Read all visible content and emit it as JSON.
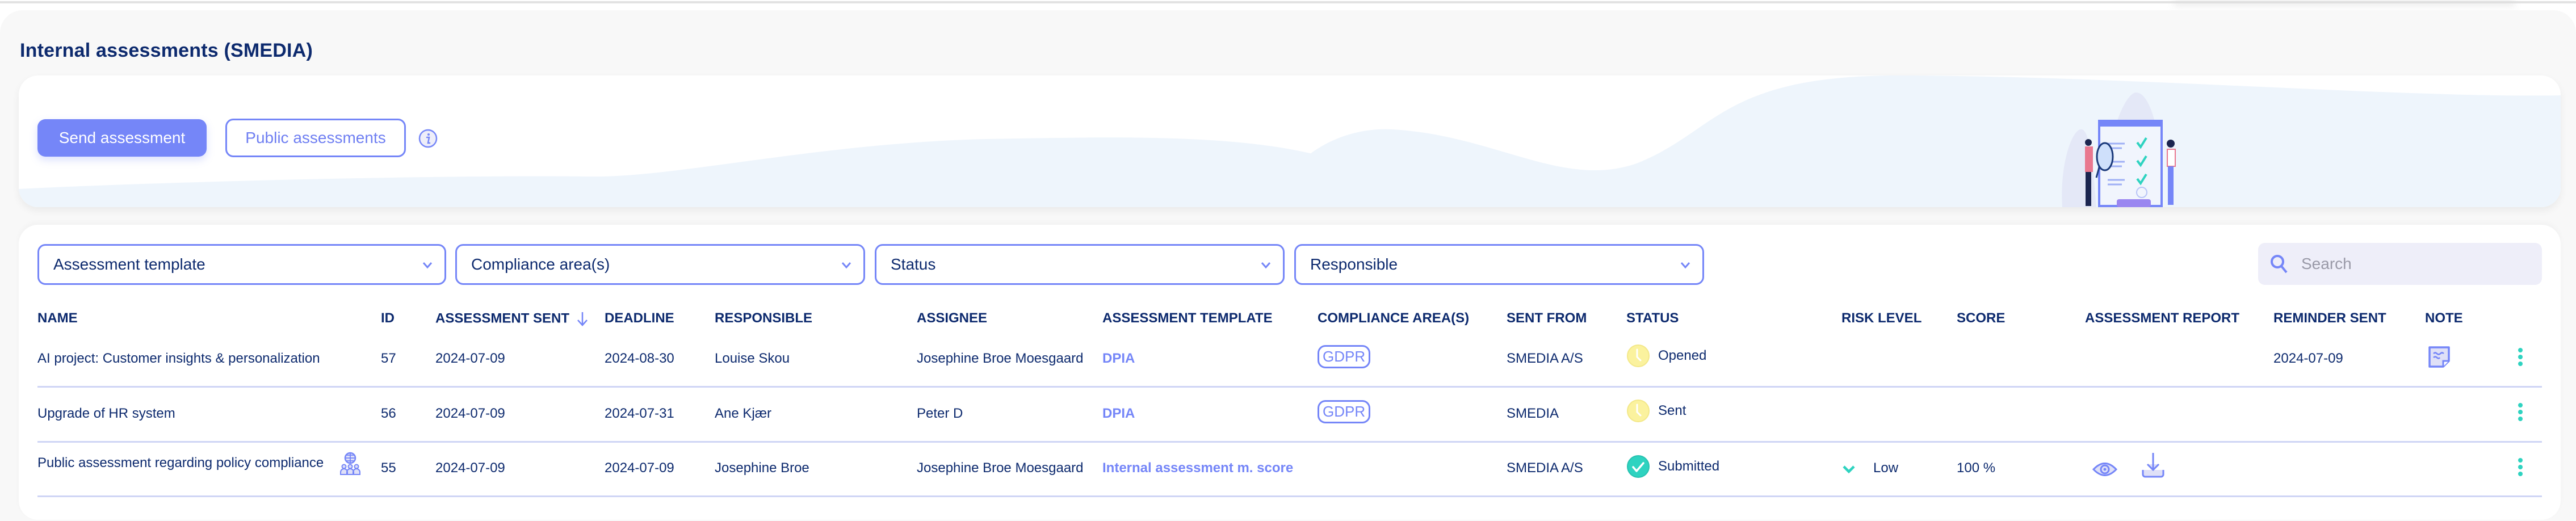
{
  "page": {
    "title": "Internal assessments (SMEDIA)"
  },
  "banner": {
    "send_label": "Send assessment",
    "public_label": "Public assessments",
    "info_icon": "info-icon"
  },
  "filters": [
    {
      "label": "Assessment template"
    },
    {
      "label": "Compliance area(s)"
    },
    {
      "label": "Status"
    },
    {
      "label": "Responsible"
    }
  ],
  "search": {
    "placeholder": "Search",
    "value": ""
  },
  "table": {
    "columns": [
      "NAME",
      "ID",
      "ASSESSMENT SENT",
      "DEADLINE",
      "RESPONSIBLE",
      "ASSIGNEE",
      "ASSESSMENT TEMPLATE",
      "COMPLIANCE AREA(S)",
      "SENT FROM",
      "STATUS",
      "RISK LEVEL",
      "SCORE",
      "ASSESSMENT REPORT",
      "REMINDER SENT",
      "NOTE"
    ],
    "sorted_column": "ASSESSMENT SENT",
    "sort_direction": "descending",
    "rows": [
      {
        "name": "AI project: Customer insights & personalization",
        "public": false,
        "id": "57",
        "sent": "2024-07-09",
        "deadline": "2024-08-30",
        "responsible": "Louise Skou",
        "assignee": "Josephine Broe Moesgaard",
        "template": "DPIA",
        "compliance": "GDPR",
        "sent_from": "SMEDIA A/S",
        "status": "Opened",
        "status_icon": "clock-icon",
        "risk": "",
        "score": "",
        "report": false,
        "reminder": "2024-07-09",
        "note": true
      },
      {
        "name": "Upgrade of HR system",
        "public": false,
        "id": "56",
        "sent": "2024-07-09",
        "deadline": "2024-07-31",
        "responsible": "Ane Kjær",
        "assignee": "Peter D",
        "template": "DPIA",
        "compliance": "GDPR",
        "sent_from": "SMEDIA",
        "status": "Sent",
        "status_icon": "clock-icon",
        "risk": "",
        "score": "",
        "report": false,
        "reminder": "",
        "note": false
      },
      {
        "name": "Public assessment regarding policy compliance",
        "public": true,
        "id": "55",
        "sent": "2024-07-09",
        "deadline": "2024-07-09",
        "responsible": "Josephine Broe",
        "assignee": "Josephine Broe Moesgaard",
        "template": "Internal assessment m. score",
        "compliance": "",
        "sent_from": "SMEDIA A/S",
        "status": "Submitted",
        "status_icon": "check-circle-icon",
        "risk": "Low",
        "score": "100 %",
        "report": true,
        "reminder": "",
        "note": false
      }
    ]
  },
  "colors": {
    "primary": "#7586f8",
    "navy": "#0d2a6e",
    "teal": "#2ed3c0",
    "pending_yellow": "#fbf29e",
    "row_separator": "#cfd5f5"
  }
}
